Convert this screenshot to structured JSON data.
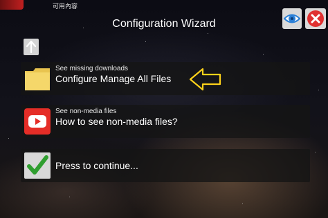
{
  "topbar": {
    "app_label": "可用內容"
  },
  "header": {
    "title": "Configuration Wizard"
  },
  "actions": {
    "eye_icon": "eye-icon",
    "close_icon": "close-icon",
    "up_icon": "up-arrow-icon"
  },
  "options": [
    {
      "subtitle": "See missing downloads",
      "label": "Configure Manage All Files",
      "icon": "folder-icon"
    },
    {
      "subtitle": "See non-media files",
      "label": "How to see non-media files?",
      "icon": "youtube-icon"
    },
    {
      "subtitle": "",
      "label": "Press to continue...",
      "icon": "checkmark-icon"
    }
  ],
  "colors": {
    "highlight_arrow": "#ffd21a",
    "close_red": "#e03030",
    "check_green": "#2f9e2f",
    "youtube_red": "#e52d27",
    "folder_yellow": "#f5d76a"
  }
}
